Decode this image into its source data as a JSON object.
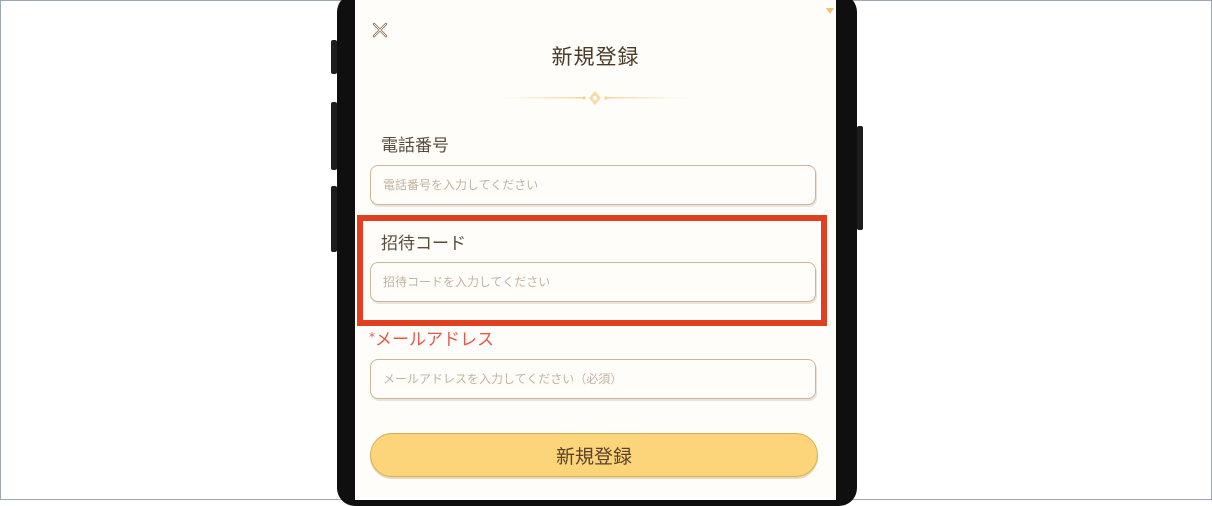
{
  "modal": {
    "title": "新規登録"
  },
  "form": {
    "phone": {
      "label": "電話番号",
      "placeholder": "電話番号を入力してください",
      "value": ""
    },
    "invite": {
      "label": "招待コード",
      "placeholder": "招待コードを入力してください",
      "value": ""
    },
    "email": {
      "required_mark": "*",
      "label": "メールアドレス",
      "placeholder": "メールアドレスを入力してください（必須）",
      "value": ""
    }
  },
  "actions": {
    "register_label": "新規登録"
  },
  "icons": {
    "close": "close-icon",
    "divider": "ornament-divider-icon"
  },
  "colors": {
    "primary_button": "#fcd57a",
    "required_label": "#e8584a",
    "highlight_annotation": "#e0401f",
    "text": "#4a3a28"
  }
}
